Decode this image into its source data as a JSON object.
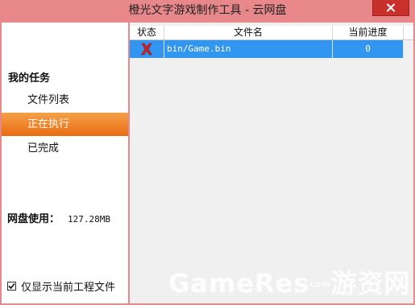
{
  "window": {
    "title": "橙光文字游戏制作工具 - 云网盘",
    "close_icon": "close-icon"
  },
  "sidebar": {
    "task_header": "我的任务",
    "items": [
      {
        "label": "文件列表",
        "active": false
      },
      {
        "label": "正在执行",
        "active": true
      },
      {
        "label": "已完成",
        "active": false
      }
    ],
    "disk_usage_label": "网盘使用：",
    "disk_usage_value": "127.28MB",
    "checkbox_label": "仅显示当前工程文件",
    "checkbox_checked": true
  },
  "table": {
    "columns": [
      "状态",
      "文件名",
      "当前进度"
    ],
    "rows": [
      {
        "status_icon": "error-x-icon",
        "filename": "bin/Game.bin",
        "progress": "0"
      }
    ]
  },
  "watermark": {
    "text": "GameRes",
    "small": "com",
    "cn": "游资网"
  },
  "colors": {
    "window_frame": "#e8888a",
    "active_item": "#ea6b10",
    "selected_row": "#3296f0",
    "error_icon": "#d42020"
  }
}
